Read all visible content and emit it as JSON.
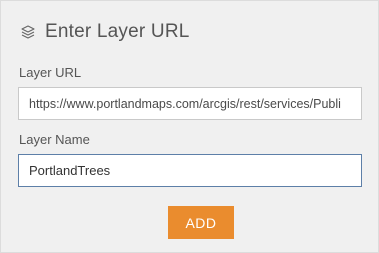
{
  "header": {
    "title": "Enter Layer URL",
    "icon": "layers-icon"
  },
  "form": {
    "url_label": "Layer URL",
    "url_value": "https://www.portlandmaps.com/arcgis/rest/services/Publi",
    "name_label": "Layer Name",
    "name_value": "PortlandTrees",
    "add_label": "ADD"
  },
  "colors": {
    "panel_bg": "#f0f0f0",
    "accent": "#ea8c2e",
    "focus_border": "#5d7fa8",
    "text": "#555555"
  }
}
